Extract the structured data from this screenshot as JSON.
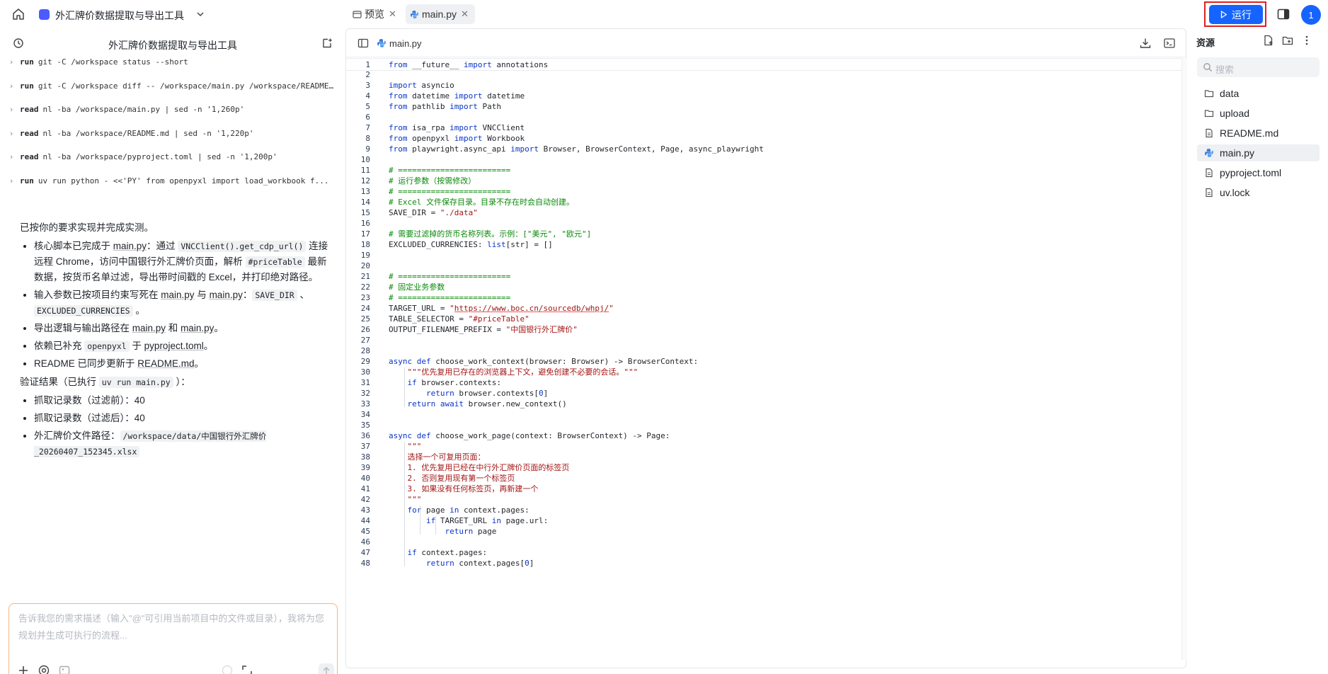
{
  "app": {
    "project_title": "外汇牌价数据提取与导出工具",
    "tabs": [
      {
        "label": "预览",
        "active": false
      },
      {
        "label": "main.py",
        "active": true
      }
    ],
    "run_label": "运行",
    "avatar_text": "1",
    "accent_color": "#1664ff"
  },
  "chat": {
    "title": "外汇牌价数据提取与导出工具",
    "commands": [
      {
        "verb": "run",
        "text": "git -C /workspace status --short"
      },
      {
        "verb": "run",
        "text": "git -C /workspace diff -- /workspace/main.py /workspace/README.md"
      },
      {
        "verb": "read",
        "text": "nl -ba /workspace/main.py | sed -n '1,260p'"
      },
      {
        "verb": "read",
        "text": "nl -ba /workspace/README.md | sed -n '1,220p'"
      },
      {
        "verb": "read",
        "text": "nl -ba /workspace/pyproject.toml | sed -n '1,200p'"
      },
      {
        "verb": "run",
        "text": "uv run python - <<'PY' from openpyxl import load_workbook f..."
      }
    ],
    "message": {
      "intro": "已按你的要求实现并完成实测。",
      "b1_a": "核心脚本已完成于 ",
      "b1_link": "main.py",
      "b1_b": "：通过 ",
      "b1_code1": "VNCClient().get_cdp_url()",
      "b1_c": " 连接远程 Chrome，访问中国银行外汇牌价页面，解析 ",
      "b1_code2": "#priceTable",
      "b1_d": " 最新数据，按货币名单过滤，导出带时间戳的 Excel，并打印绝对路径。",
      "b2_a": "输入参数已按项目约束写死在 ",
      "b2_link1": "main.py",
      "b2_b": " 与 ",
      "b2_link2": "main.py",
      "b2_c": "：",
      "b2_code1": "SAVE_DIR",
      "b2_sep": " 、 ",
      "b2_code2": "EXCLUDED_CURRENCIES",
      "b2_d": " 。",
      "b3_a": "导出逻辑与输出路径在 ",
      "b3_link1": "main.py",
      "b3_b": " 和 ",
      "b3_link2": "main.py",
      "b3_c": "。",
      "b4_a": "依赖已补充 ",
      "b4_code": "openpyxl",
      "b4_b": " 于 ",
      "b4_link": "pyproject.toml",
      "b4_c": "。",
      "b5_a": "README 已同步更新于 ",
      "b5_link": "README.md",
      "b5_b": "。",
      "verify_a": "验证结果（已执行 ",
      "verify_code": "uv run main.py",
      "verify_b": " ）：",
      "r1": "抓取记录数（过滤前）：40",
      "r2": "抓取记录数（过滤后）：40",
      "r3_a": "外汇牌价文件路径：",
      "r3_code": "/workspace/data/中国银行外汇牌价_20260407_152345.xlsx"
    },
    "composer_placeholder": "告诉我您的需求描述（输入\"@\"可引用当前项目中的文件或目录），我将为您规划并生成可执行的流程..."
  },
  "editor": {
    "file_name": "main.py",
    "lines": [
      "from __future__ import annotations",
      "",
      "import asyncio",
      "from datetime import datetime",
      "from pathlib import Path",
      "",
      "from isa_rpa import VNCClient",
      "from openpyxl import Workbook",
      "from playwright.async_api import Browser, BrowserContext, Page, async_playwright",
      "",
      "# ========================",
      "# 运行参数（按需修改）",
      "# ========================",
      "# Excel 文件保存目录。目录不存在时会自动创建。",
      "SAVE_DIR = \"./data\"",
      "",
      "# 需要过滤掉的货币名称列表。示例：[\"美元\", \"欧元\"]",
      "EXCLUDED_CURRENCIES: list[str] = []",
      "",
      "",
      "# ========================",
      "# 固定业务参数",
      "# ========================",
      "TARGET_URL = \"https://www.boc.cn/sourcedb/whpj/\"",
      "TABLE_SELECTOR = \"#priceTable\"",
      "OUTPUT_FILENAME_PREFIX = \"中国银行外汇牌价\"",
      "",
      "",
      "async def choose_work_context(browser: Browser) -> BrowserContext:",
      "    \"\"\"优先复用已存在的浏览器上下文，避免创建不必要的会话。\"\"\"",
      "    if browser.contexts:",
      "        return browser.contexts[0]",
      "    return await browser.new_context()",
      "",
      "",
      "async def choose_work_page(context: BrowserContext) -> Page:",
      "    \"\"\"",
      "    选择一个可复用页面：",
      "    1. 优先复用已经在中行外汇牌价页面的标签页",
      "    2. 否则复用现有第一个标签页",
      "    3. 如果没有任何标签页，再新建一个",
      "    \"\"\"",
      "    for page in context.pages:",
      "        if TARGET_URL in page.url:",
      "            return page",
      "",
      "    if context.pages:",
      "        return context.pages[0]"
    ]
  },
  "resources": {
    "title": "资源",
    "search_placeholder": "搜索",
    "items": [
      {
        "name": "data",
        "type": "folder"
      },
      {
        "name": "upload",
        "type": "folder"
      },
      {
        "name": "README.md",
        "type": "file"
      },
      {
        "name": "main.py",
        "type": "python"
      },
      {
        "name": "pyproject.toml",
        "type": "file"
      },
      {
        "name": "uv.lock",
        "type": "file"
      }
    ]
  }
}
